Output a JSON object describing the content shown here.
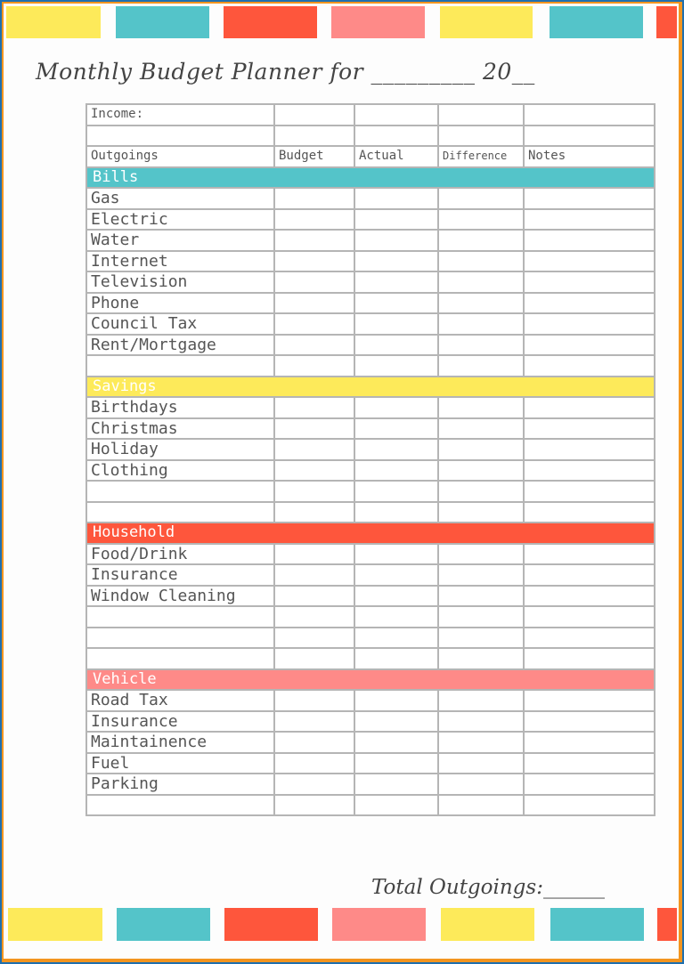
{
  "page": {
    "title": "Monthly Budget Planner for _________ 20__",
    "total_label": "Total Outgoings:______",
    "colors": {
      "yellow": "#fdea5a",
      "teal": "#54c4c9",
      "red": "#fe563c",
      "pink": "#fe8a88",
      "border_orange": "#f3951f",
      "border_blue": "#1f6fae"
    }
  },
  "table": {
    "income_label": "Income:",
    "headers": [
      "Outgoings",
      "Budget",
      "Actual",
      "Difference",
      "Notes"
    ],
    "sections": [
      {
        "name": "Bills",
        "color": "teal",
        "items": [
          "Gas",
          "Electric",
          "Water",
          "Internet",
          "Television",
          "Phone",
          "Council Tax",
          "Rent/Mortgage",
          ""
        ]
      },
      {
        "name": "Savings",
        "color": "yellow",
        "items": [
          "Birthdays",
          "Christmas",
          "Holiday",
          "Clothing",
          "",
          ""
        ]
      },
      {
        "name": "Household",
        "color": "red",
        "items": [
          "Food/Drink",
          "Insurance",
          "Window Cleaning",
          "",
          "",
          ""
        ]
      },
      {
        "name": "Vehicle",
        "color": "pink",
        "items": [
          "Road Tax",
          "Insurance",
          "Maintainence",
          "Fuel",
          "Parking",
          ""
        ]
      }
    ]
  }
}
